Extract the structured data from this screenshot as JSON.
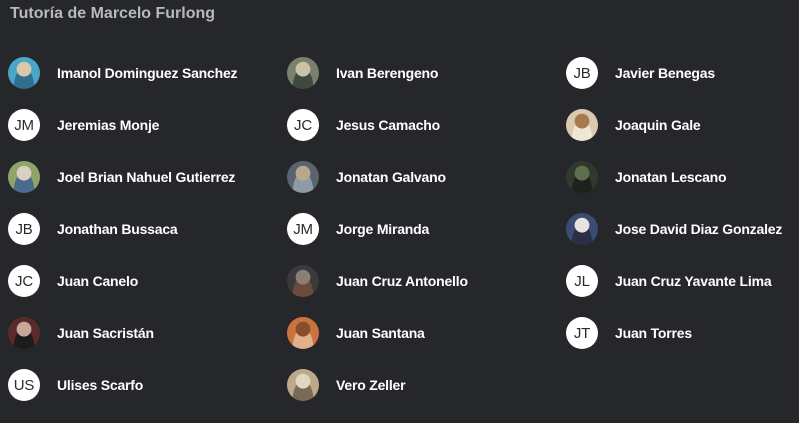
{
  "title": "Tutoría de Marcelo Furlong",
  "members": [
    {
      "name": "Imanol Dominguez Sanchez",
      "initials": "",
      "photo": true,
      "colors": [
        "#4aa6c8",
        "#d8c7a8",
        "#2f6f8f"
      ]
    },
    {
      "name": "Ivan Berengeno",
      "initials": "",
      "photo": true,
      "colors": [
        "#7b7f6d",
        "#c9c2a8",
        "#3e4a3b"
      ]
    },
    {
      "name": "Javier Benegas",
      "initials": "JB",
      "photo": false
    },
    {
      "name": "Jeremias Monje",
      "initials": "JM",
      "photo": false
    },
    {
      "name": "Jesus Camacho",
      "initials": "JC",
      "photo": false
    },
    {
      "name": "Joaquin Gale",
      "initials": "",
      "photo": true,
      "colors": [
        "#d9c9b0",
        "#a8794f",
        "#f0e6d6"
      ]
    },
    {
      "name": "Joel Brian Nahuel Gutierrez",
      "initials": "",
      "photo": true,
      "colors": [
        "#8fa46b",
        "#d8d1c4",
        "#4b6b8e"
      ]
    },
    {
      "name": "Jonatan Galvano",
      "initials": "",
      "photo": true,
      "colors": [
        "#5a6470",
        "#b9a98a",
        "#8e9aa6"
      ]
    },
    {
      "name": "Jonatan Lescano",
      "initials": "",
      "photo": true,
      "colors": [
        "#2f3a2c",
        "#5e6f4e",
        "#1d221c"
      ]
    },
    {
      "name": "Jonathan Bussaca",
      "initials": "JB",
      "photo": false
    },
    {
      "name": "Jorge Miranda",
      "initials": "JM",
      "photo": false
    },
    {
      "name": "Jose David Diaz Gonzalez",
      "initials": "",
      "photo": true,
      "colors": [
        "#3c4b73",
        "#e6e4e0",
        "#2a2f45"
      ]
    },
    {
      "name": "Juan Canelo",
      "initials": "JC",
      "photo": false
    },
    {
      "name": "Juan Cruz Antonello",
      "initials": "",
      "photo": true,
      "colors": [
        "#3a3a3a",
        "#8a7f76",
        "#6b4b3b"
      ]
    },
    {
      "name": "Juan Cruz Yavante Lima",
      "initials": "JL",
      "photo": false
    },
    {
      "name": "Juan Sacristán",
      "initials": "",
      "photo": true,
      "colors": [
        "#5b2b2b",
        "#c8a898",
        "#1e1b1b"
      ]
    },
    {
      "name": "Juan Santana",
      "initials": "",
      "photo": true,
      "colors": [
        "#c9743f",
        "#8a4d2c",
        "#e2b08a"
      ]
    },
    {
      "name": "Juan Torres",
      "initials": "JT",
      "photo": false
    },
    {
      "name": "Ulises Scarfo",
      "initials": "US",
      "photo": false
    },
    {
      "name": "Vero Zeller",
      "initials": "",
      "photo": true,
      "colors": [
        "#bca98a",
        "#e0d6c4",
        "#7a6a55"
      ]
    }
  ]
}
